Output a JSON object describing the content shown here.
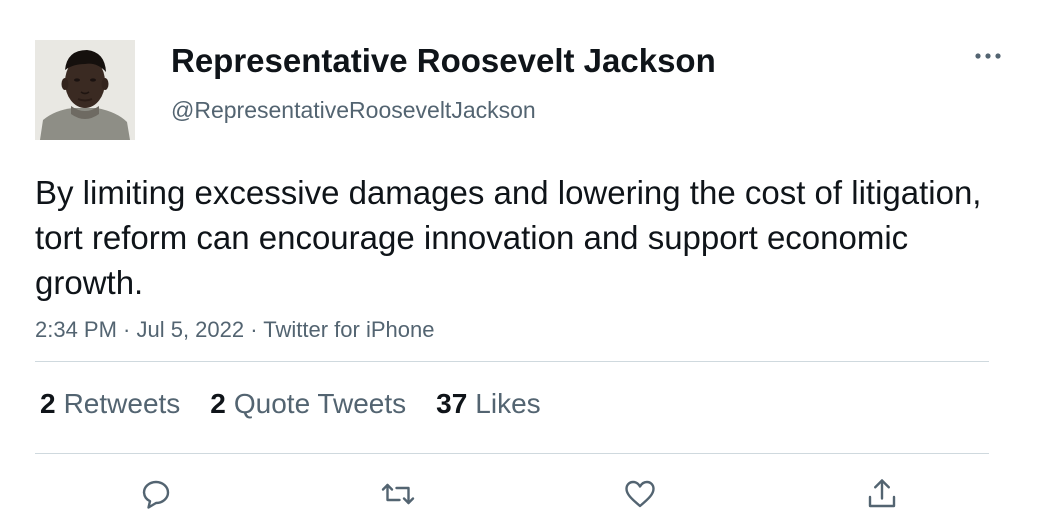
{
  "author": {
    "display_name": "Representative Roosevelt Jackson",
    "handle": "@RepresentativeRooseveltJackson"
  },
  "tweet": {
    "text": "By limiting excessive damages and lowering the cost of litigation, tort reform can encourage innovation and support economic growth.",
    "meta": "2:34 PM · Jul 5, 2022 · Twitter for iPhone"
  },
  "stats": {
    "retweets_count": "2",
    "retweets_label": "Retweets",
    "quotes_count": "2",
    "quotes_label": "Quote Tweets",
    "likes_count": "37",
    "likes_label": "Likes"
  },
  "icons": {
    "more": "more-horizontal-icon",
    "reply": "reply-icon",
    "retweet": "retweet-icon",
    "like": "heart-icon",
    "share": "share-icon"
  },
  "colors": {
    "text_primary": "#0f1419",
    "text_secondary": "#536471",
    "divider": "#cfd9de",
    "icon": "#536471"
  }
}
